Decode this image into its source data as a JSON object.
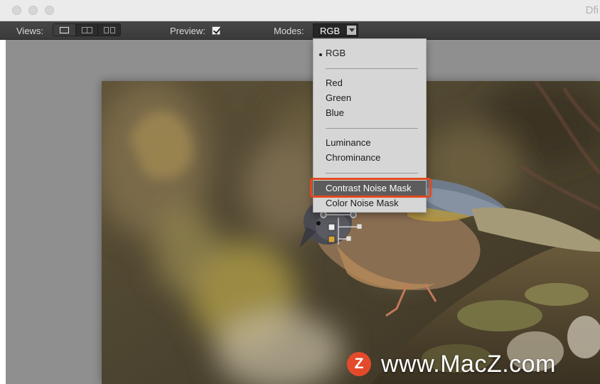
{
  "window": {
    "title": "Dfi"
  },
  "toolbar": {
    "views_label": "Views:",
    "preview_label": "Preview:",
    "preview_checked": true,
    "modes_label": "Modes:",
    "mode_value": "RGB"
  },
  "modes_menu": {
    "items": [
      "RGB",
      "Red",
      "Green",
      "Blue",
      "Luminance",
      "Chrominance",
      "Contrast Noise Mask",
      "Color Noise Mask"
    ],
    "checked_item": "RGB",
    "highlighted_item": "Contrast Noise Mask"
  },
  "watermark": {
    "logo_letter": "Z",
    "text": "www.MacZ.com"
  },
  "colors": {
    "accent_callout": "#e2491f",
    "watermark_logo": "#e34a2b",
    "menu_highlight": "#5c5c5c"
  }
}
